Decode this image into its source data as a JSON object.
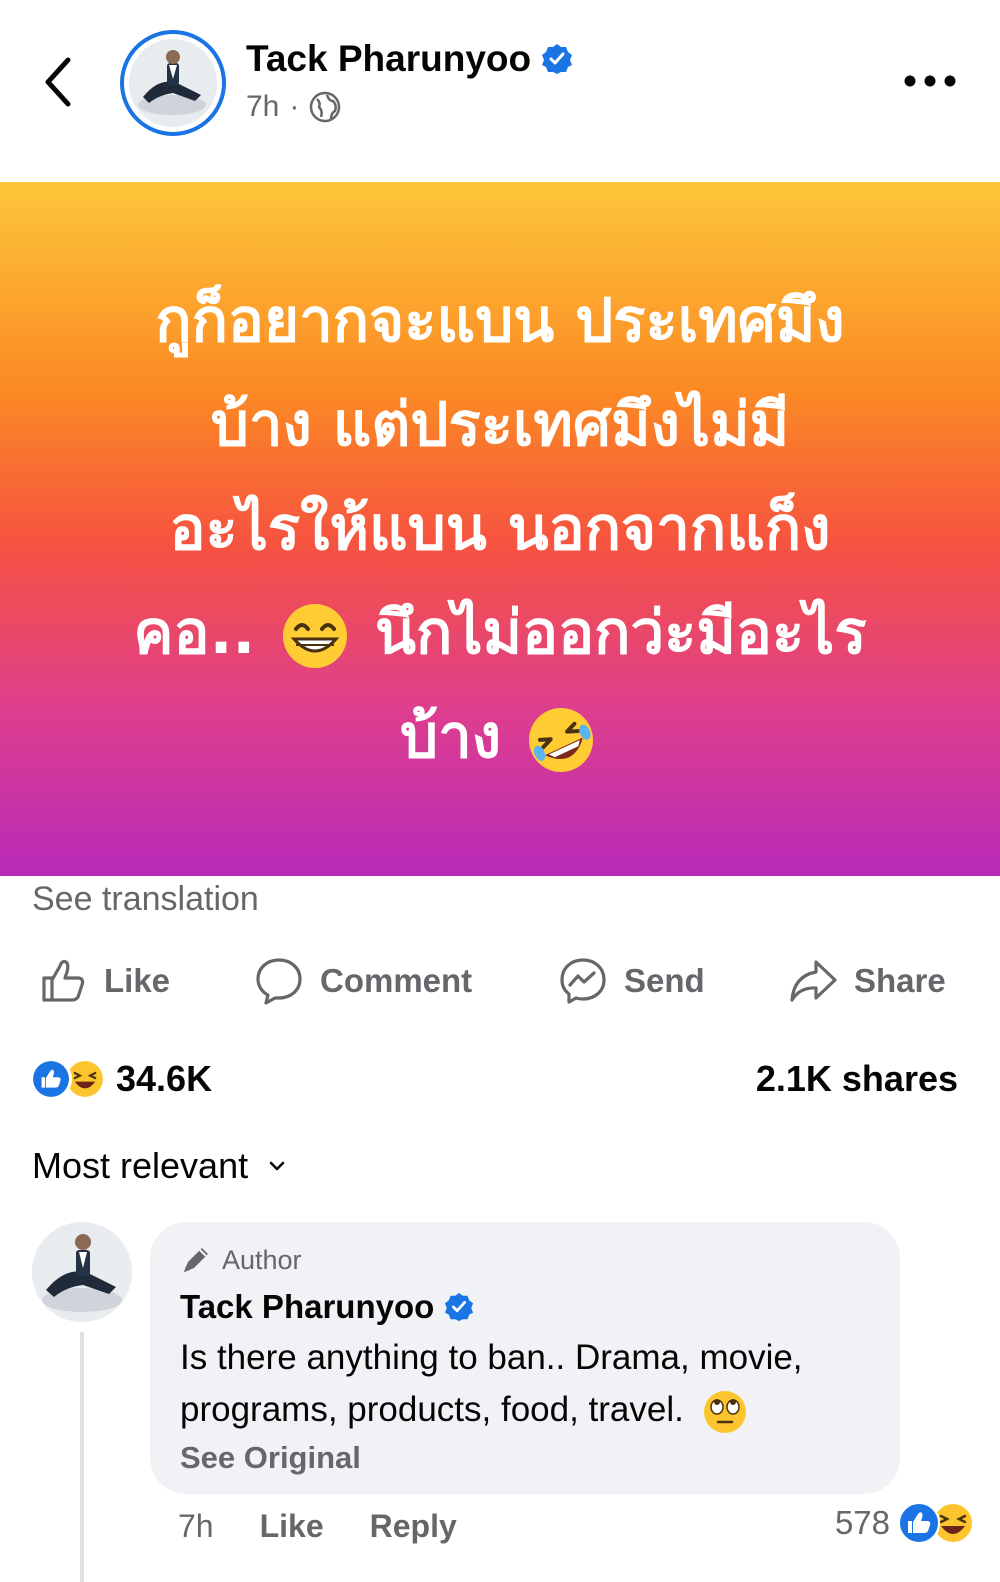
{
  "header": {
    "author": "Tack Pharunyoo",
    "time": "7h",
    "separator": "·",
    "icons": [
      "back-arrow-icon",
      "verified-badge-icon",
      "globe-icon",
      "more-dots-icon"
    ]
  },
  "post": {
    "text_line1": "กูก็อยากจะแบน ประเทศมึง",
    "text_line2": "บ้าง แต่ประเทศมึงไม่มี",
    "text_line3": "อะไรให้แบน นอกจากแก็ง",
    "text_line4a": "คอ..",
    "text_line4b": "นึกไม่ออกว่ะมีอะไร",
    "text_line5": "บ้าง",
    "gradient_colors": [
      "#fdc63a",
      "#fb8a24",
      "#f6533f",
      "#de3e8e",
      "#b82ab8"
    ],
    "see_translation": "See translation"
  },
  "actions": {
    "like": "Like",
    "comment": "Comment",
    "send": "Send",
    "share": "Share"
  },
  "stats": {
    "reactions_count": "34.6K",
    "shares": "2.1K shares"
  },
  "sort": {
    "label": "Most relevant"
  },
  "comment": {
    "badge": "Author",
    "name": "Tack Pharunyoo",
    "text_line1": "Is there anything to ban.. Drama, movie,",
    "text_line2": "programs, products, food, travel.",
    "see_original": "See Original",
    "time": "7h",
    "like": "Like",
    "reply": "Reply",
    "reaction_count": "578"
  },
  "colors": {
    "accent": "#1b74e4",
    "secondary_text": "#65676b",
    "bubble": "#f0f2f5"
  }
}
